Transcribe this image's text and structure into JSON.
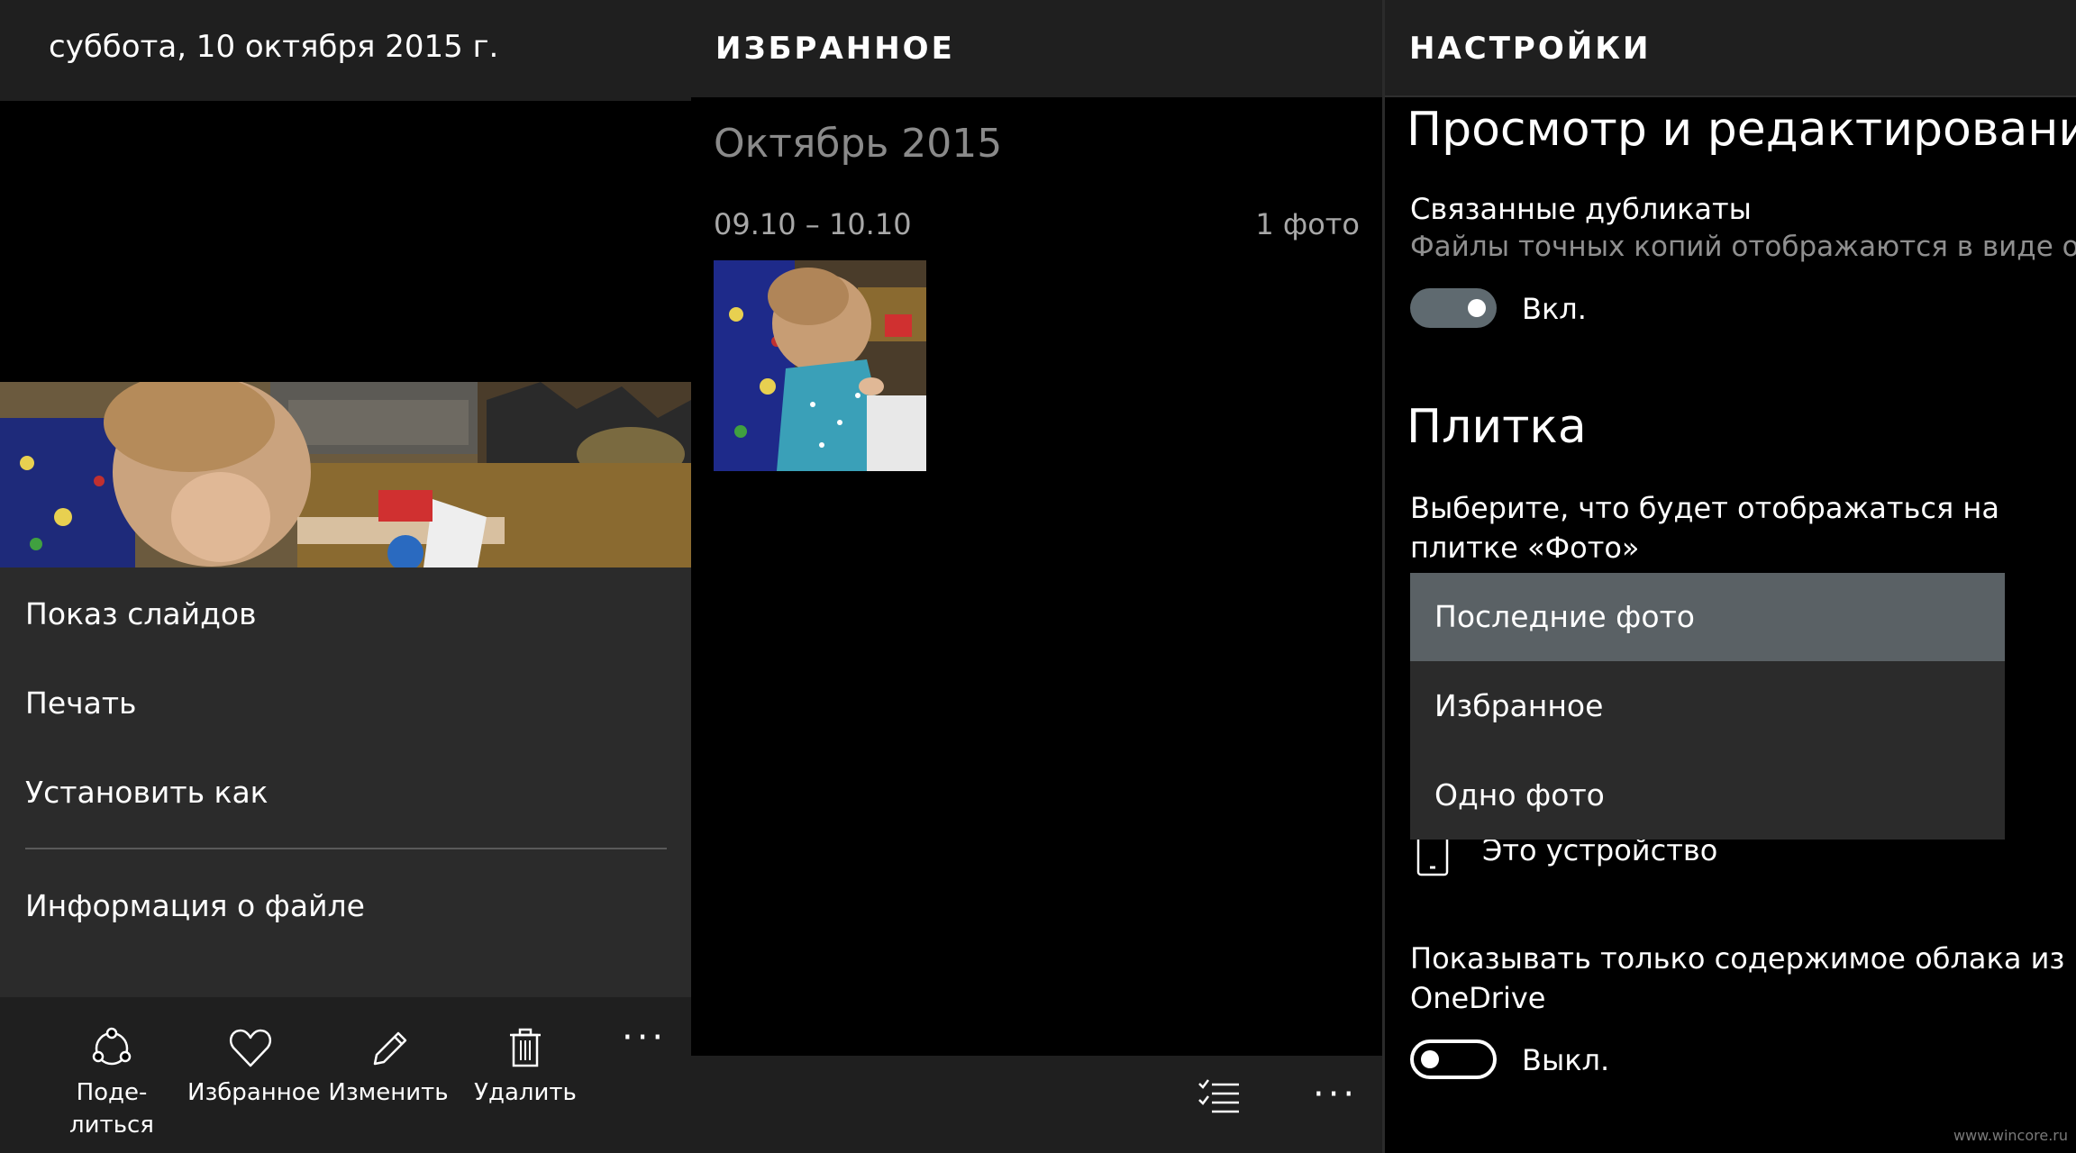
{
  "left": {
    "date": "суббота, 10 октября 2015 г.",
    "menu": [
      "Показ слайдов",
      "Печать",
      "Установить как",
      "Информация о файле"
    ],
    "appbar": [
      {
        "label": "Поде-\nлиться",
        "icon": "share-icon"
      },
      {
        "label": "Избранное",
        "icon": "heart-icon"
      },
      {
        "label": "Изменить",
        "icon": "pencil-icon"
      },
      {
        "label": "Удалить",
        "icon": "trash-icon"
      }
    ],
    "more": "···"
  },
  "middle": {
    "title": "ИЗБРАННОЕ",
    "month": "Октябрь 2015",
    "range": "09.10 – 10.10",
    "count": "1 фото",
    "more": "···"
  },
  "right": {
    "title": "НАСТРОЙКИ",
    "section1": "Просмотр и редактирование",
    "duplicates_label": "Связанные дубликаты",
    "duplicates_desc": "Файлы точных копий отображаются в виде од",
    "duplicates_state": "Вкл.",
    "section2": "Плитка",
    "tile_label_1": "Выберите, что будет отображаться на",
    "tile_label_2": "плитке «Фото»",
    "dropdown": [
      "Последние фото",
      "Избранное",
      "Одно фото"
    ],
    "device": "Это устройство",
    "onedrive_label_1": "Показывать только содержимое облака из",
    "onedrive_label_2": "OneDrive",
    "onedrive_state": "Выкл.",
    "watermark": "www.wincore.ru"
  },
  "colors": {
    "header_bg": "#1f1f1f",
    "menu_bg": "#2b2b2b",
    "selected_option": "#5a6165",
    "toggle_on": "#5f6a70",
    "muted_text": "#8a8a8a"
  }
}
